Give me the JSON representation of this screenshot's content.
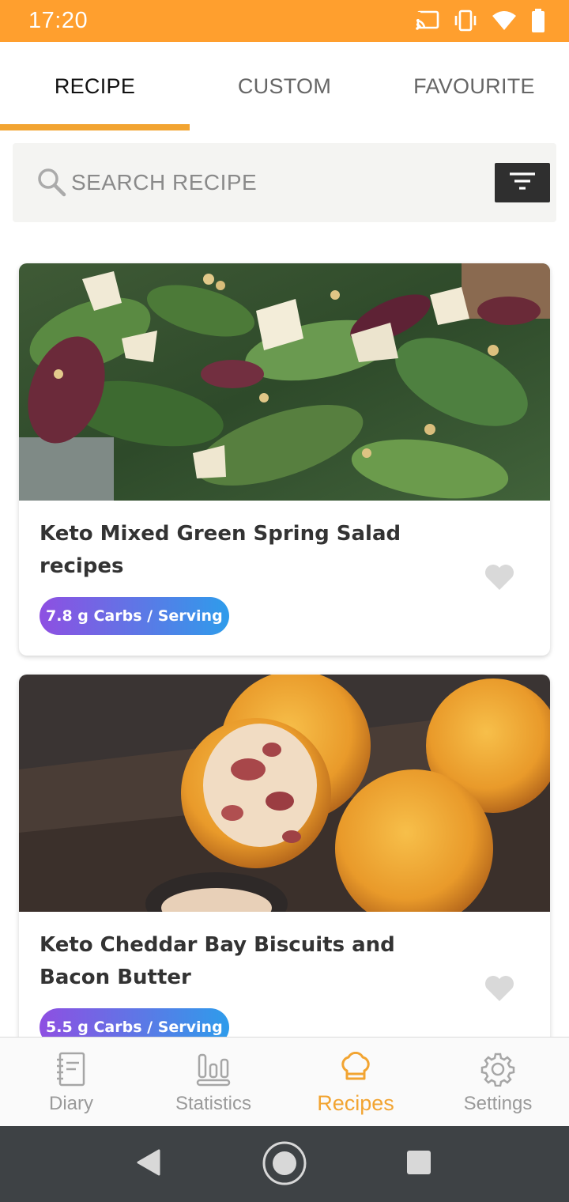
{
  "status_bar": {
    "time": "17:20",
    "icons": [
      "cast-icon",
      "vibrate-icon",
      "wifi-icon",
      "battery-icon"
    ]
  },
  "tabs": [
    {
      "label": "RECIPE",
      "active": true
    },
    {
      "label": "CUSTOM",
      "active": false
    },
    {
      "label": "FAVOURITE",
      "active": false
    }
  ],
  "search": {
    "placeholder": "SEARCH RECIPE",
    "value": ""
  },
  "recipes": [
    {
      "title": "Keto Mixed Green Spring Salad recipes",
      "carbs": "7.8 g Carbs / Serving",
      "favourite": false,
      "image": "mixed-green-salad-photo"
    },
    {
      "title": "Keto Cheddar Bay Biscuits and Bacon Butter",
      "carbs": "5.5 g Carbs / Serving",
      "favourite": false,
      "image": "cheddar-biscuits-photo"
    }
  ],
  "bottom_nav": [
    {
      "label": "Diary",
      "icon": "diary-icon",
      "active": false
    },
    {
      "label": "Statistics",
      "icon": "statistics-icon",
      "active": false
    },
    {
      "label": "Recipes",
      "icon": "chef-hat-icon",
      "active": true
    },
    {
      "label": "Settings",
      "icon": "gear-icon",
      "active": false
    }
  ],
  "colors": {
    "accent": "#F2A431",
    "status_bar": "#FF9F2E",
    "badge_gradient": [
      "#8E4FE2",
      "#2E9CEB"
    ],
    "heart": "#D9D9D9",
    "system_nav": "#3E4245"
  }
}
